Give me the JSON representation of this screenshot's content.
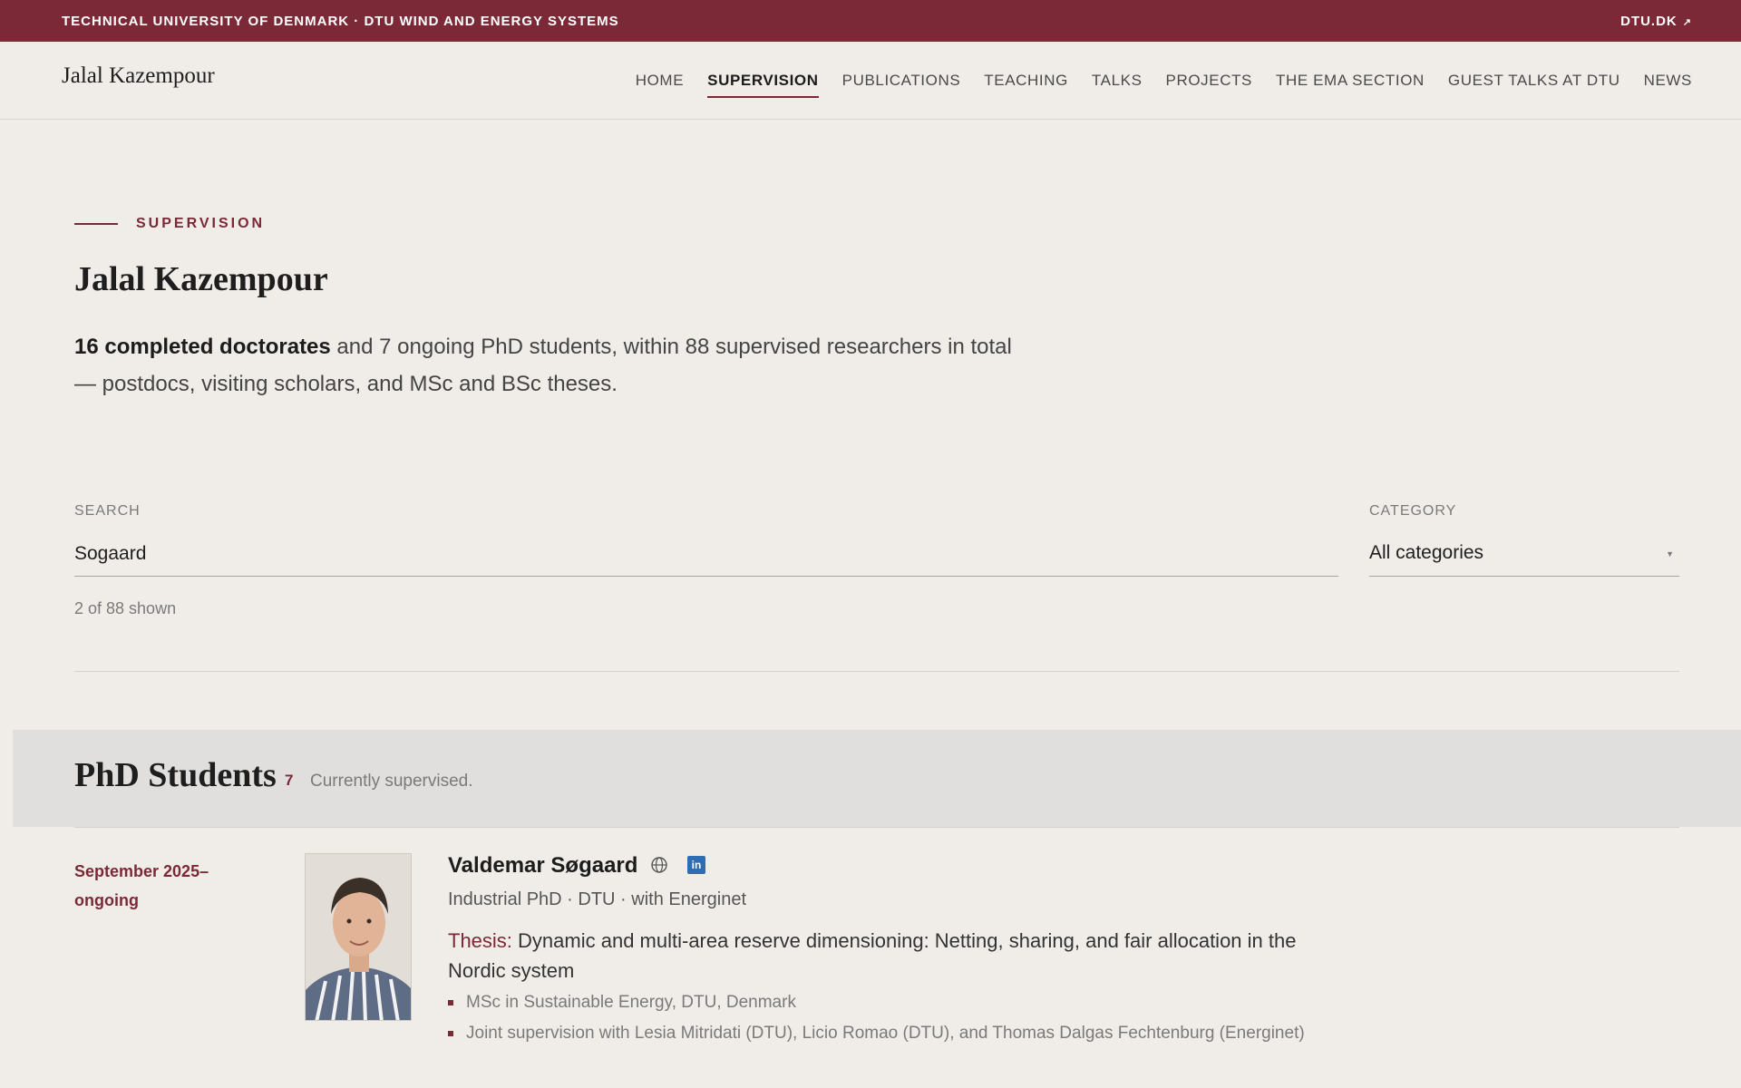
{
  "topbar": {
    "institution": "Technical University of Denmark · DTU Wind and Energy Systems",
    "external_link": "DTU.DK",
    "external_icon": "↗"
  },
  "header": {
    "brand": "Jalal Kazempour",
    "nav": [
      {
        "label": "HOME",
        "active": false
      },
      {
        "label": "SUPERVISION",
        "active": true
      },
      {
        "label": "PUBLICATIONS",
        "active": false
      },
      {
        "label": "TEACHING",
        "active": false
      },
      {
        "label": "TALKS",
        "active": false
      },
      {
        "label": "PROJECTS",
        "active": false
      },
      {
        "label": "THE EMA SECTION",
        "active": false
      },
      {
        "label": "GUEST TALKS AT DTU",
        "active": false
      },
      {
        "label": "NEWS",
        "active": false
      }
    ]
  },
  "hero": {
    "eyebrow": "Supervision",
    "title": "Jalal Kazempour",
    "lead_strong": "16 completed doctorates",
    "lead_rest": " and 7 ongoing PhD students, within 88 supervised researchers in total — postdocs, visiting scholars, and MSc and BSc theses."
  },
  "filters": {
    "search_label": "Search",
    "search_value": "Sogaard",
    "category_label": "Category",
    "category_value": "All categories",
    "count_text": "2 of 88 shown"
  },
  "section": {
    "title": "PhD Students",
    "count": "7",
    "description": "Currently supervised."
  },
  "person": {
    "date": "September 2025–ongoing",
    "name": "Valdemar Søgaard",
    "linkedin_label": "in",
    "role": "Industrial PhD · DTU · with Energinet",
    "thesis_label": "Thesis:",
    "thesis_text": " Dynamic and multi-area reserve dimensioning: Netting, sharing, and fair allocation in the Nordic system",
    "bullets": [
      "MSc in Sustainable Energy, DTU, Denmark",
      "Joint supervision with Lesia Mitridati (DTU), Licio Romao (DTU), and Thomas Dalgas Fechtenburg (Energinet)"
    ]
  },
  "colors": {
    "accent": "#7b2936",
    "background": "#f0ede8",
    "band": "#e0dfde",
    "linkedin": "#2c6db3"
  }
}
